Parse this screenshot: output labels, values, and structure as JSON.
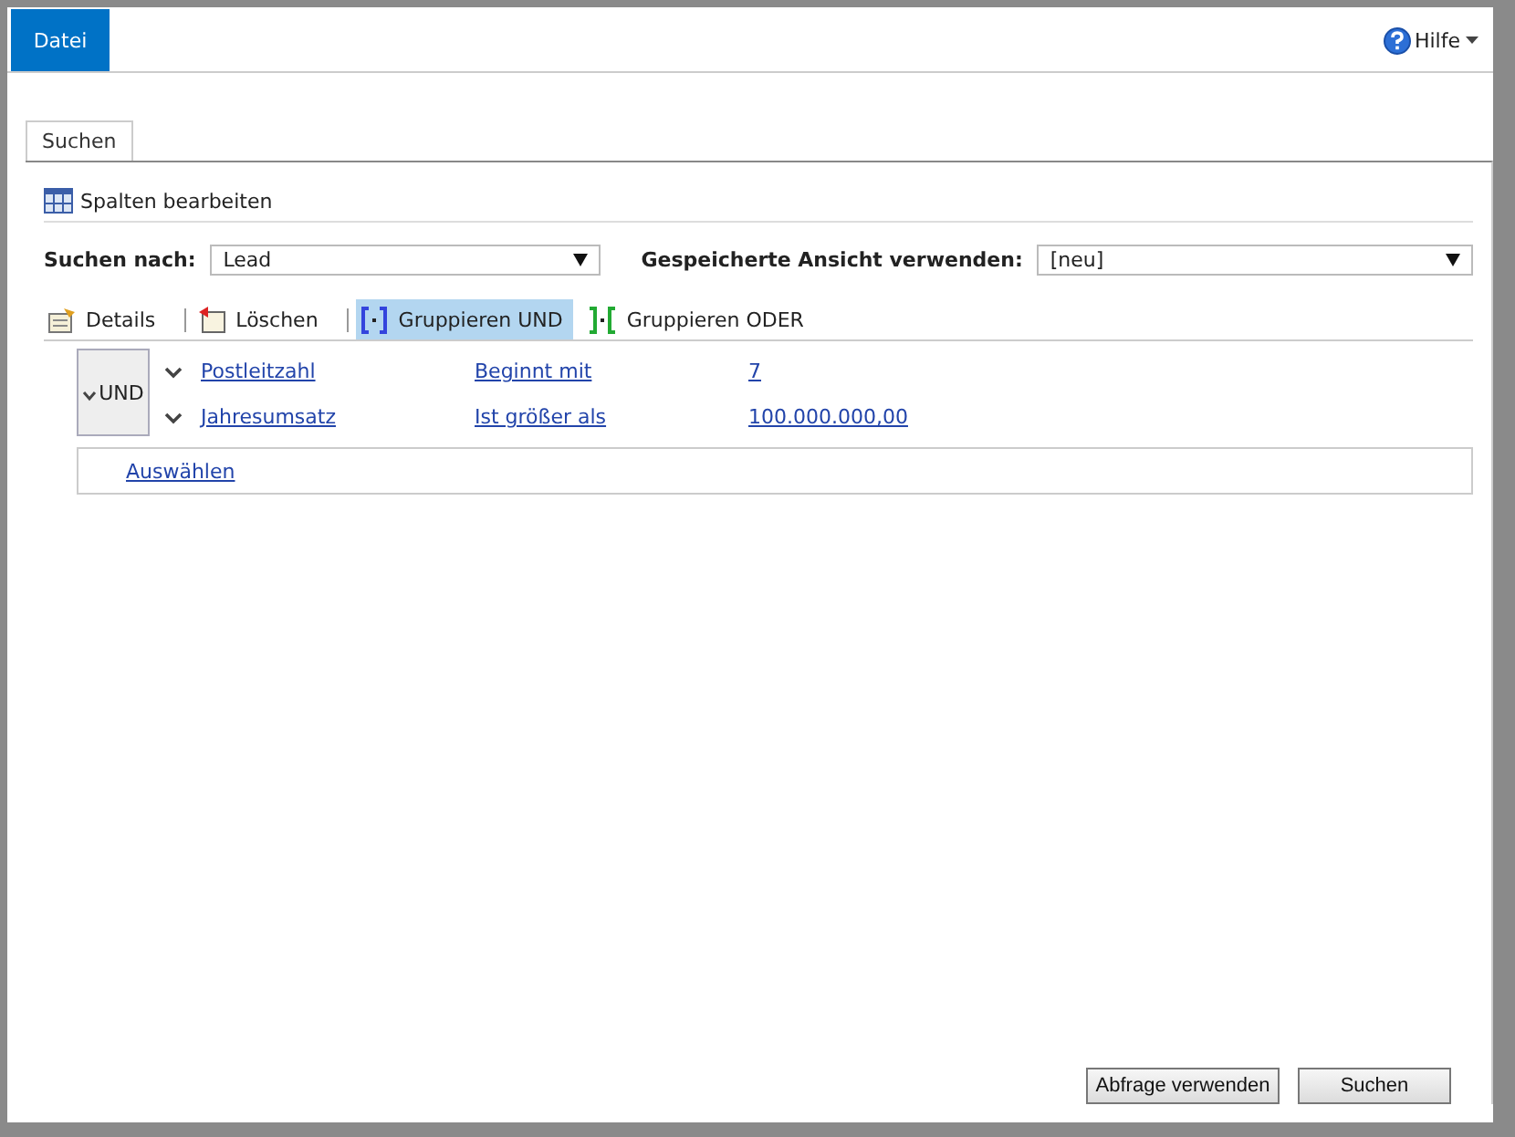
{
  "ribbon": {
    "file_tab": "Datei",
    "help": "Hilfe"
  },
  "tabs": [
    {
      "label": "Suchen",
      "selected": true
    }
  ],
  "edit_columns": "Spalten bearbeiten",
  "search_for": {
    "label": "Suchen nach:",
    "value": "Lead"
  },
  "saved_view": {
    "label": "Gespeicherte Ansicht verwenden:",
    "value": "[neu]"
  },
  "toolbar": [
    {
      "kind": "details",
      "label": "Details",
      "selected": false
    },
    {
      "kind": "delete",
      "label": "Löschen",
      "selected": false
    },
    {
      "kind": "group_and",
      "label": "Gruppieren UND",
      "selected": true
    },
    {
      "kind": "group_or",
      "label": "Gruppieren ODER",
      "selected": false
    }
  ],
  "group": {
    "label": "UND",
    "conditions": [
      {
        "field": "Postleitzahl",
        "operator": "Beginnt mit",
        "value": "7"
      },
      {
        "field": "Jahresumsatz",
        "operator": "Ist größer als",
        "value": "100.000.000,00"
      }
    ]
  },
  "select_link": "Auswählen",
  "buttons": [
    "Abfrage verwenden",
    "Suchen"
  ]
}
